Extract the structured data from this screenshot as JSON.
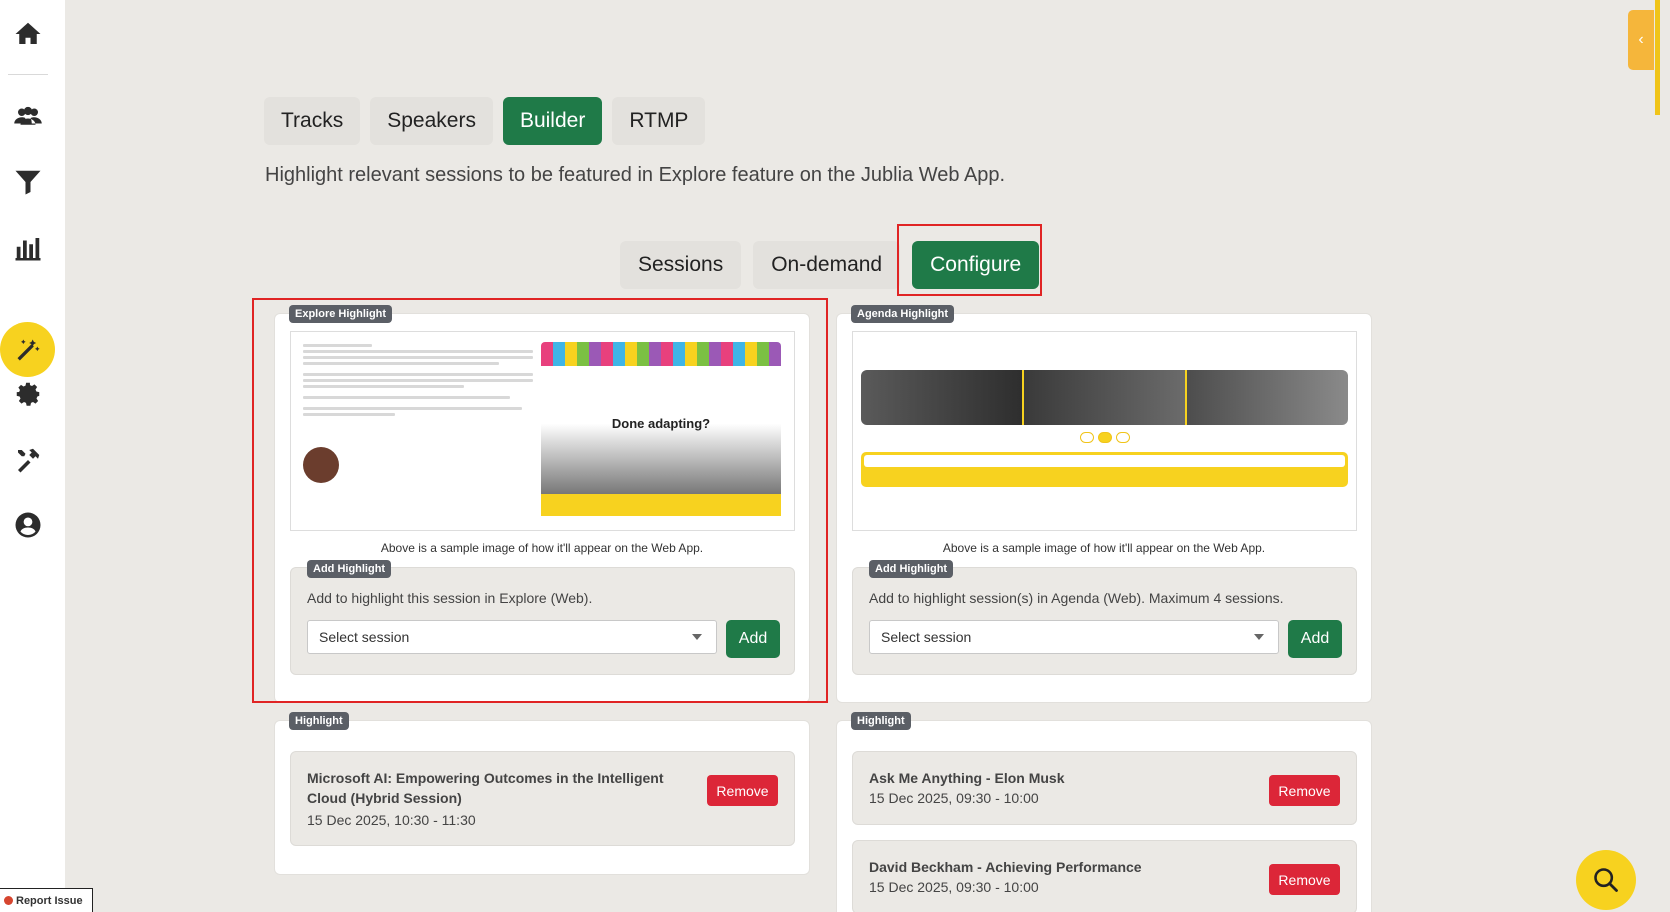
{
  "sidebar": {
    "items": [
      "home-icon",
      "users-icon",
      "filter-icon",
      "chart-icon",
      "magic-wand-icon",
      "settings-icon",
      "tools-icon",
      "account-icon"
    ],
    "active": "magic-wand-icon"
  },
  "tabs": [
    {
      "label": "Tracks",
      "active": false
    },
    {
      "label": "Speakers",
      "active": false
    },
    {
      "label": "Builder",
      "active": true
    },
    {
      "label": "RTMP",
      "active": false
    }
  ],
  "description": "Highlight relevant sessions to be featured in Explore feature on the Jublia Web App.",
  "subtabs": [
    {
      "label": "Sessions",
      "active": false
    },
    {
      "label": "On-demand",
      "active": false
    },
    {
      "label": "Configure",
      "active": true
    }
  ],
  "explore": {
    "badge": "Explore Highlight",
    "preview_video_title": "Done adapting?",
    "caption": "Above is a sample image of how it'll appear on the Web App.",
    "add_badge": "Add Highlight",
    "hint": "Add to highlight this session in Explore (Web).",
    "select_placeholder": "Select session",
    "add_label": "Add"
  },
  "agenda": {
    "badge": "Agenda Highlight",
    "caption": "Above is a sample image of how it'll appear on the Web App.",
    "add_badge": "Add Highlight",
    "hint": "Add to highlight session(s) in Agenda (Web). Maximum 4 sessions.",
    "select_placeholder": "Select session",
    "add_label": "Add"
  },
  "explore_highlights": {
    "badge": "Highlight",
    "items": [
      {
        "title": "Microsoft AI: Empowering Outcomes in the Intelligent Cloud (Hybrid Session)",
        "date": "15 Dec 2025, 10:30 - 11:30",
        "remove_label": "Remove"
      }
    ]
  },
  "agenda_highlights": {
    "badge": "Highlight",
    "items": [
      {
        "title": "Ask Me Anything - Elon Musk",
        "date": "15 Dec 2025, 09:30 - 10:00",
        "remove_label": "Remove"
      },
      {
        "title": "David Beckham - Achieving Performance",
        "date": "15 Dec 2025, 09:30 - 10:00",
        "remove_label": "Remove"
      }
    ]
  },
  "report_issue": "Report Issue",
  "colors": {
    "primary": "#1f7a48",
    "danger": "#dc2638",
    "accent": "#f7d21f",
    "highlight_box": "#e02424"
  }
}
